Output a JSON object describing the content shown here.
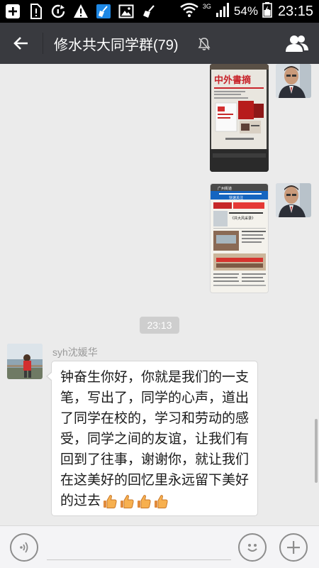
{
  "status_bar": {
    "left_icons": [
      "add-icon",
      "sim-warning-icon",
      "sync-icon",
      "warning-icon",
      "broom-icon",
      "image-icon",
      "broom-icon"
    ],
    "network_label": "3G",
    "battery": "54%",
    "time": "23:15"
  },
  "header": {
    "title": "修水共大同学群(79)",
    "muted": true,
    "back_icon": "arrow-left-icon",
    "members_icon": "group-members-icon"
  },
  "messages": {
    "timestamp": "23:13",
    "incoming": {
      "sender": "syh沈媛华",
      "text": "钟奋生你好，你就是我们的一支笔，写出了，同学的心声，道出了同学在校的，学习和劳动的感受，同学之间的友谊，让我们有回到了往事，谢谢你，就让我们在这美好的回忆里永远留下美好的过去",
      "emoji_count": 4,
      "emoji_icon": "thumbs-up-icon"
    },
    "outgoing_images": [
      {
        "kind": "photo",
        "masthead": "中外書摘"
      },
      {
        "kind": "screenshot",
        "top_label": "广州街道",
        "banner": "快速关注",
        "subtitle": "《共大风采录》"
      }
    ]
  },
  "input_bar": {
    "placeholder": "",
    "voice_icon": "voice-icon",
    "emoji_icon": "smiley-icon",
    "more_icon": "plus-icon"
  },
  "colors": {
    "header_bg": "#393a3f",
    "chat_bg": "#ebebeb",
    "bubble_bg": "#ffffff"
  }
}
